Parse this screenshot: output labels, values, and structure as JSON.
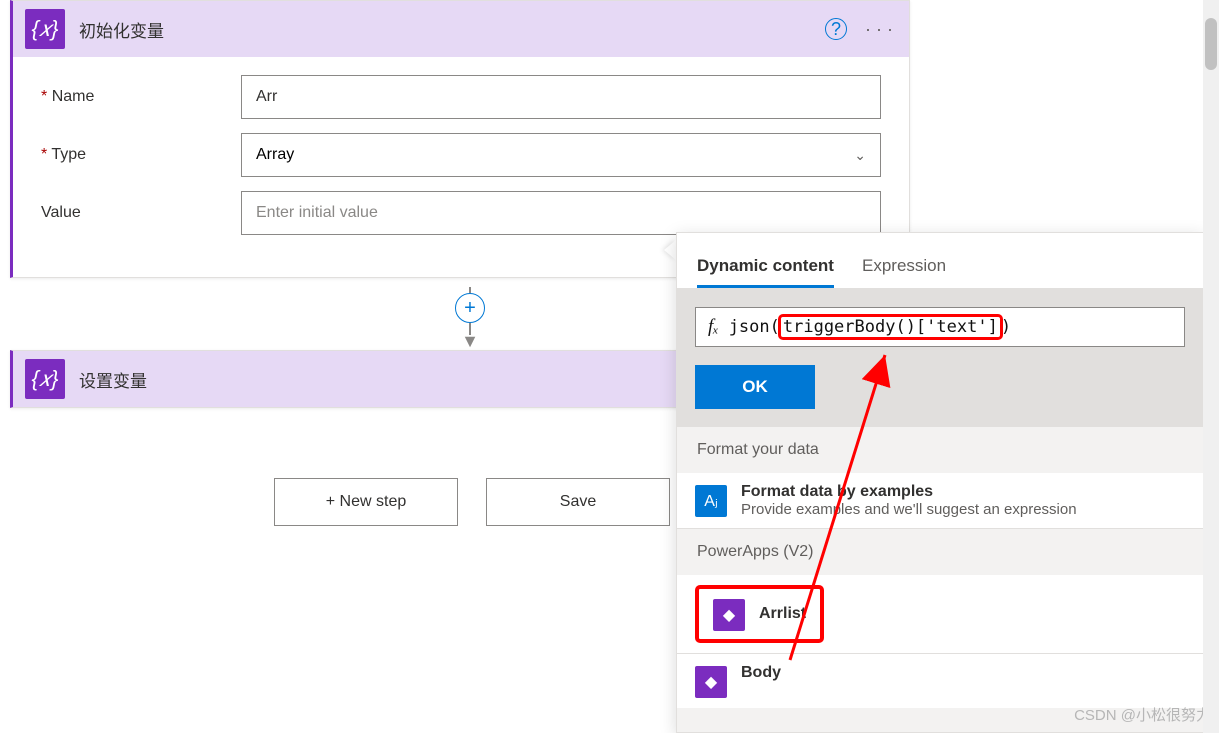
{
  "card1": {
    "title": "初始化变量",
    "name_label": "Name",
    "name_value": "Arr",
    "type_label": "Type",
    "type_value": "Array",
    "value_label": "Value",
    "value_placeholder": "Enter initial value"
  },
  "card2": {
    "title": "设置变量"
  },
  "buttons": {
    "new_step": "+ New step",
    "save": "Save"
  },
  "dc": {
    "tab_dynamic": "Dynamic content",
    "tab_expression": "Expression",
    "fx_label": "fₓ",
    "expr_prefix": "json(",
    "expr_highlight": "triggerBody()['text']",
    "expr_suffix": ")",
    "ok": "OK",
    "section_format": "Format your data",
    "format_item_title": "Format data by examples",
    "format_item_sub": "Provide examples and we'll suggest an expression",
    "section_pa": "PowerApps (V2)",
    "pa_item1": "Arrlist",
    "pa_item2": "Body"
  },
  "watermark": "CSDN @小松很努力"
}
